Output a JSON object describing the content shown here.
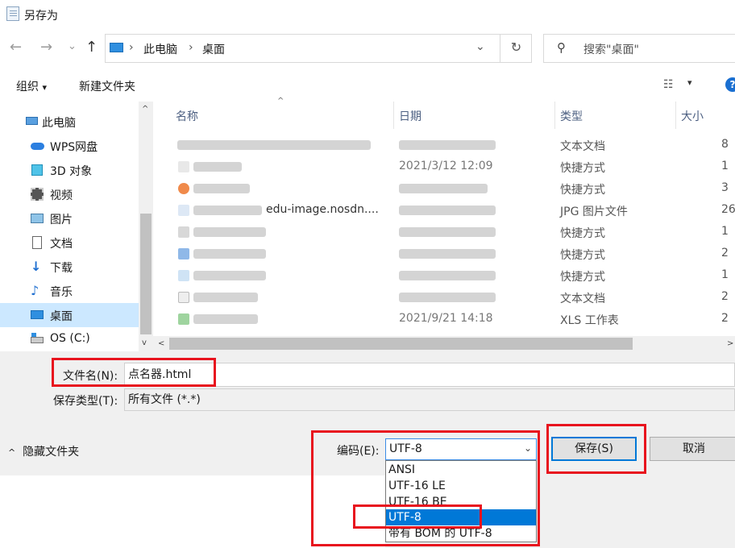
{
  "window": {
    "title": "另存为"
  },
  "nav": {
    "back": "←",
    "forward": "→",
    "recent": "⌄",
    "up": "↑",
    "breadcrumb": [
      "此电脑",
      "桌面"
    ],
    "refresh": "↻",
    "search_placeholder": "搜索\"桌面\""
  },
  "toolbar": {
    "organize": "组织",
    "organize_caret": "▾",
    "new_folder": "新建文件夹",
    "view": "☷",
    "view_caret": "▾",
    "help": "?"
  },
  "sidebar": {
    "items": [
      {
        "label": "此电脑",
        "icon": "computer-icon"
      },
      {
        "label": "WPS网盘",
        "icon": "cloud-icon"
      },
      {
        "label": "3D 对象",
        "icon": "cube-icon"
      },
      {
        "label": "视频",
        "icon": "video-icon"
      },
      {
        "label": "图片",
        "icon": "picture-icon"
      },
      {
        "label": "文档",
        "icon": "document-icon"
      },
      {
        "label": "下载",
        "icon": "download-icon"
      },
      {
        "label": "音乐",
        "icon": "music-icon"
      },
      {
        "label": "桌面",
        "icon": "desktop-icon",
        "selected": true
      },
      {
        "label": "OS (C:)",
        "icon": "drive-icon"
      }
    ]
  },
  "columns": {
    "name": "名称",
    "date": "日期",
    "type": "类型",
    "size": "大小"
  },
  "files": [
    {
      "name": "",
      "date": "",
      "type": "文本文档",
      "size": "8"
    },
    {
      "name": "",
      "date": "2021/3/12 12:09",
      "type": "快捷方式",
      "size": "1"
    },
    {
      "name": "",
      "date": "",
      "type": "快捷方式",
      "size": "3"
    },
    {
      "name": "edu-image.nosdn....",
      "date": "",
      "type": "JPG 图片文件",
      "size": "26"
    },
    {
      "name": "",
      "date": "",
      "type": "快捷方式",
      "size": "1"
    },
    {
      "name": "",
      "date": "",
      "type": "快捷方式",
      "size": "2"
    },
    {
      "name": "",
      "date": "",
      "type": "快捷方式",
      "size": "1"
    },
    {
      "name": "",
      "date": "",
      "type": "文本文档",
      "size": "2"
    },
    {
      "name": "",
      "date": "2021/9/21 14:18",
      "type": "XLS 工作表",
      "size": "2"
    }
  ],
  "form": {
    "filename_label": "文件名(N):",
    "filename_value": "点名器.html",
    "filetype_label": "保存类型(T):",
    "filetype_value": "所有文件  (*.*)",
    "hide_folders": "隐藏文件夹",
    "hide_caret": "^",
    "encoding_label": "编码(E):",
    "encoding_value": "UTF-8",
    "encoding_options": [
      "ANSI",
      "UTF-16 LE",
      "UTF-16 BE",
      "UTF-8",
      "带有 BOM 的 UTF-8"
    ],
    "encoding_caret": "⌄",
    "save": "保存(S)",
    "cancel": "取消"
  },
  "colors": {
    "accent": "#0078d7",
    "highlight_box": "#e8131e",
    "selected_bg": "#cce8ff"
  }
}
